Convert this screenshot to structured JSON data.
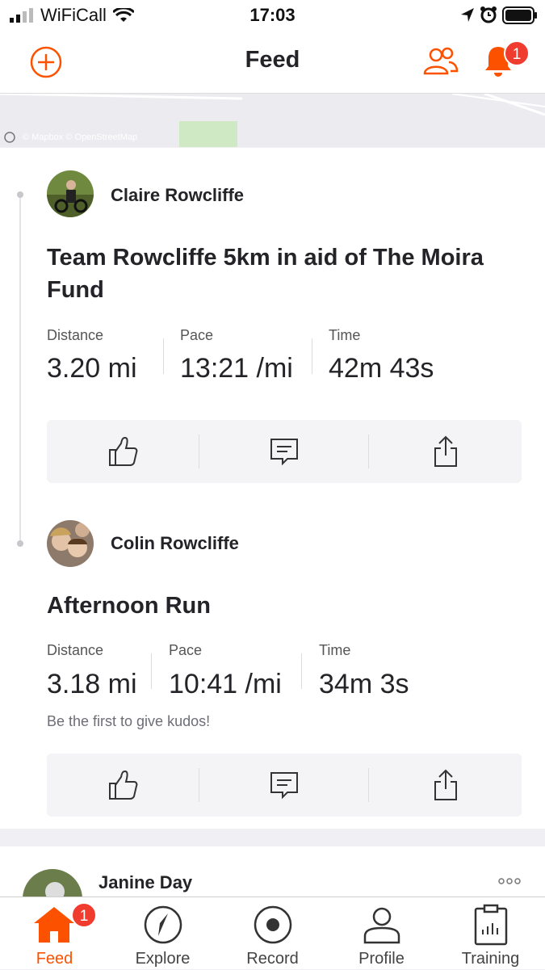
{
  "status_bar": {
    "carrier": "WiFiCall",
    "time": "17:03"
  },
  "header": {
    "title": "Feed",
    "notification_count": "1"
  },
  "map": {
    "attribution": "© Mapbox © OpenStreetMap"
  },
  "feed": [
    {
      "athlete": "Claire Rowcliffe",
      "title": "Team Rowcliffe 5km in aid of The Moira Fund",
      "stats": [
        {
          "label": "Distance",
          "value": "3.20 mi"
        },
        {
          "label": "Pace",
          "value": "13:21 /mi"
        },
        {
          "label": "Time",
          "value": "42m 43s"
        }
      ]
    },
    {
      "athlete": "Colin Rowcliffe",
      "title": "Afternoon Run",
      "stats": [
        {
          "label": "Distance",
          "value": "3.18 mi"
        },
        {
          "label": "Pace",
          "value": "10:41 /mi"
        },
        {
          "label": "Time",
          "value": "34m 3s"
        }
      ],
      "kudos_prompt": "Be the first to give kudos!"
    },
    {
      "athlete": "Janine Day"
    }
  ],
  "tabs": [
    {
      "label": "Feed",
      "badge": "1",
      "active": true
    },
    {
      "label": "Explore"
    },
    {
      "label": "Record"
    },
    {
      "label": "Profile"
    },
    {
      "label": "Training"
    }
  ],
  "colors": {
    "accent": "#fc5200",
    "badge": "#f03c2e",
    "text": "#242428"
  }
}
